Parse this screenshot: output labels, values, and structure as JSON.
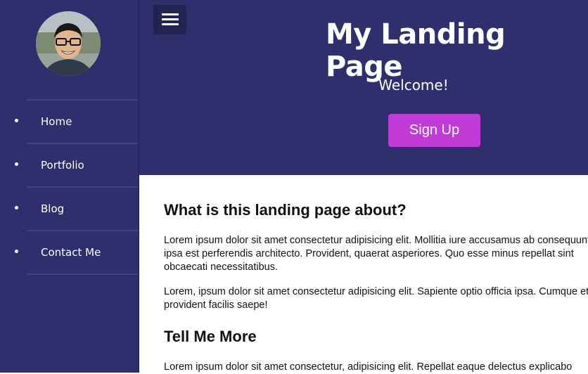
{
  "sidebar": {
    "items": [
      {
        "label": "Home"
      },
      {
        "label": "Portfolio"
      },
      {
        "label": "Blog"
      },
      {
        "label": "Contact Me"
      }
    ]
  },
  "hero": {
    "title": "My Landing Page",
    "subtitle": "Welcome!",
    "signup_label": "Sign Up"
  },
  "content": {
    "about_heading": "What is this landing page about?",
    "paragraph1": "Lorem ipsum dolor sit amet consectetur adipisicing elit. Mollitia iure accusamus ab consequuntur ipsa est perferendis architecto. Provident, quaerat asperiores. Quo esse minus repellat sint obcaecati necessitatibus.",
    "paragraph2": "Lorem, ipsum dolor sit amet consectetur adipisicing elit. Sapiente optio officia ipsa. Cumque et non provident facilis saepe!",
    "more_heading": "Tell Me More",
    "paragraph3": "Lorem ipsum dolor sit amet consectetur, adipisicing elit. Repellat eaque delectus explicabo"
  },
  "colors": {
    "sidebar_bg": "#2e2f6c",
    "hero_bg": "#2e2f6c",
    "accent": "#c13bd6",
    "menu_button_bg": "#222353"
  },
  "icons": {
    "menu": "hamburger-menu-icon",
    "avatar": "profile-avatar"
  }
}
